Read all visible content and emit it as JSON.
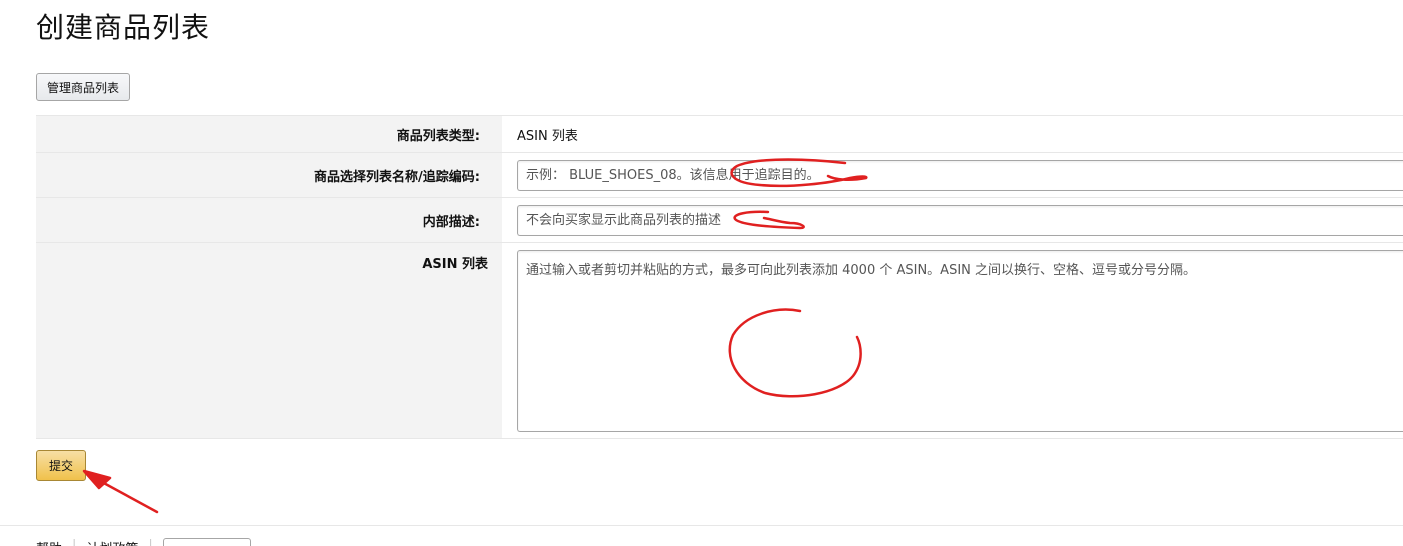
{
  "page": {
    "title": "创建商品列表"
  },
  "toolbar": {
    "manage_label": "管理商品列表"
  },
  "form": {
    "type_label": "商品列表类型:",
    "type_value": "ASIN 列表",
    "name_label": "商品选择列表名称/追踪编码:",
    "name_placeholder": "示例： BLUE_SHOES_08。该信息用于追踪目的。",
    "desc_label": "内部描述:",
    "desc_placeholder": "不会向买家显示此商品列表的描述",
    "asin_label": "ASIN 列表",
    "asin_placeholder": "通过输入或者剪切并粘贴的方式，最多可向此列表添加 4000 个 ASIN。ASIN 之间以换行、空格、逗号或分号分隔。"
  },
  "actions": {
    "submit_label": "提交"
  },
  "footer": {
    "help": "帮助",
    "policy": "计划政策"
  },
  "colors": {
    "annotation_red": "#e02020",
    "submit_yellow": "#f0c14b",
    "label_bg": "#f3f3f3"
  }
}
